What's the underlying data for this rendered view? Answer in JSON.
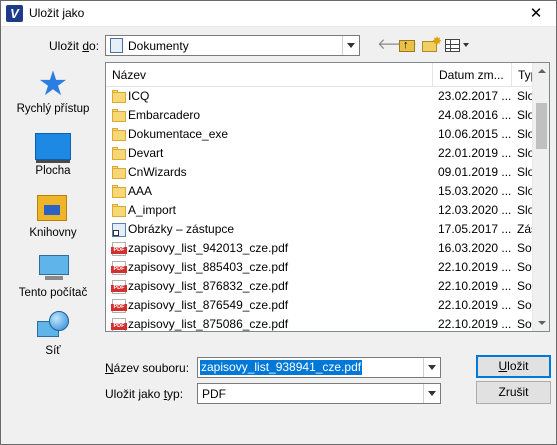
{
  "window": {
    "title": "Uložit jako",
    "app_icon_letter": "V",
    "close_glyph": "✕"
  },
  "toolbar": {
    "save_in_label_prefix": "Uložit ",
    "save_in_label_access": "d",
    "save_in_label_suffix": "o:",
    "save_in_value": "Dokumenty",
    "icons": [
      "back-arrow-icon",
      "up-one-level-icon",
      "new-folder-icon",
      "view-menu-icon"
    ]
  },
  "places": [
    {
      "label": "Rychlý přístup",
      "icon": "star-icon"
    },
    {
      "label": "Plocha",
      "icon": "desktop-icon"
    },
    {
      "label": "Knihovny",
      "icon": "libraries-icon"
    },
    {
      "label": "Tento počítač",
      "icon": "computer-icon"
    },
    {
      "label": "Síť",
      "icon": "network-icon"
    }
  ],
  "file_list": {
    "columns": {
      "name": "Název",
      "date": "Datum zm...",
      "type": "Typ"
    },
    "rows": [
      {
        "kind": "folder",
        "name": "ICQ",
        "date": "23.02.2017 ...",
        "type": "Slož"
      },
      {
        "kind": "folder",
        "name": "Embarcadero",
        "date": "24.08.2016 ...",
        "type": "Slož"
      },
      {
        "kind": "folder",
        "name": "Dokumentace_exe",
        "date": "10.06.2015 ...",
        "type": "Slož"
      },
      {
        "kind": "folder",
        "name": "Devart",
        "date": "22.01.2019 ...",
        "type": "Slož"
      },
      {
        "kind": "folder",
        "name": "CnWizards",
        "date": "09.01.2019 ...",
        "type": "Slož"
      },
      {
        "kind": "folder",
        "name": "AAA",
        "date": "15.03.2020 ...",
        "type": "Slož"
      },
      {
        "kind": "folder",
        "name": "A_import",
        "date": "12.03.2020 ...",
        "type": "Slož"
      },
      {
        "kind": "shortcut",
        "name": "Obrázky – zástupce",
        "date": "17.05.2017 ...",
        "type": "Zás"
      },
      {
        "kind": "pdf",
        "name": "zapisovy_list_942013_cze.pdf",
        "date": "16.03.2020 ...",
        "type": "Sou"
      },
      {
        "kind": "pdf",
        "name": "zapisovy_list_885403_cze.pdf",
        "date": "22.10.2019 ...",
        "type": "Sou"
      },
      {
        "kind": "pdf",
        "name": "zapisovy_list_876832_cze.pdf",
        "date": "22.10.2019 ...",
        "type": "Sou"
      },
      {
        "kind": "pdf",
        "name": "zapisovy_list_876549_cze.pdf",
        "date": "22.10.2019 ...",
        "type": "Sou"
      },
      {
        "kind": "pdf",
        "name": "zapisovy_list_875086_cze.pdf",
        "date": "22.10.2019 ...",
        "type": "Sou"
      }
    ]
  },
  "form": {
    "filename_label_access": "N",
    "filename_label_rest": "ázev souboru:",
    "filename_value": "zapisovy_list_938941_cze.pdf",
    "filetype_label_prefix": "Uložit jako ",
    "filetype_label_access": "t",
    "filetype_label_suffix": "yp:",
    "filetype_value": "PDF"
  },
  "buttons": {
    "save_access": "U",
    "save_rest": "ložit",
    "cancel": "Zrušit"
  }
}
